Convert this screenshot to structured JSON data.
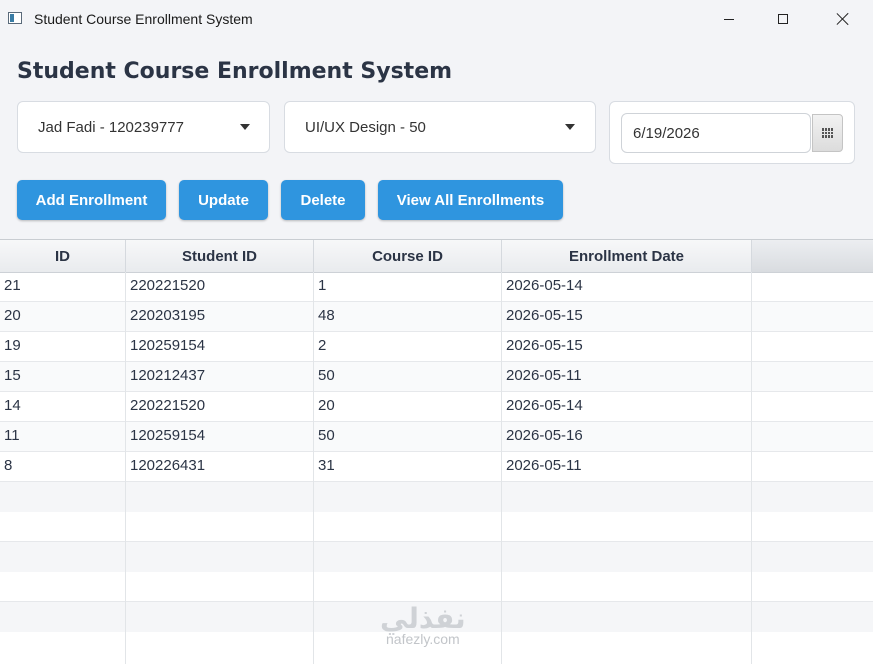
{
  "window": {
    "title": "Student Course Enrollment System"
  },
  "page": {
    "title": "Student Course Enrollment System"
  },
  "form": {
    "student_selected": "Jad Fadi - 120239777",
    "course_selected": "UI/UX Design - 50",
    "date_value": "6/19/2026"
  },
  "toolbar": {
    "add_label": "Add Enrollment",
    "update_label": "Update",
    "delete_label": "Delete",
    "view_all_label": "View All Enrollments"
  },
  "table": {
    "columns": [
      "ID",
      "Student ID",
      "Course ID",
      "Enrollment Date"
    ],
    "rows": [
      {
        "id": "21",
        "student_id": "220221520",
        "course_id": "1",
        "date": "2026-05-14"
      },
      {
        "id": "20",
        "student_id": "220203195",
        "course_id": "48",
        "date": "2026-05-15"
      },
      {
        "id": "19",
        "student_id": "120259154",
        "course_id": "2",
        "date": "2026-05-15"
      },
      {
        "id": "15",
        "student_id": "120212437",
        "course_id": "50",
        "date": "2026-05-11"
      },
      {
        "id": "14",
        "student_id": "220221520",
        "course_id": "20",
        "date": "2026-05-14"
      },
      {
        "id": "11",
        "student_id": "120259154",
        "course_id": "50",
        "date": "2026-05-16"
      },
      {
        "id": "8",
        "student_id": "120226431",
        "course_id": "31",
        "date": "2026-05-11"
      }
    ]
  },
  "watermark": {
    "arabic": "نفذلي",
    "latin": "nafezly.com"
  },
  "colors": {
    "accent": "#2f95df",
    "title_text": "#2b3445",
    "background": "#f3f4f7"
  },
  "icons": {
    "app": "app-window-icon",
    "calendar": "calendar-icon",
    "dropdown": "chevron-down-icon"
  }
}
